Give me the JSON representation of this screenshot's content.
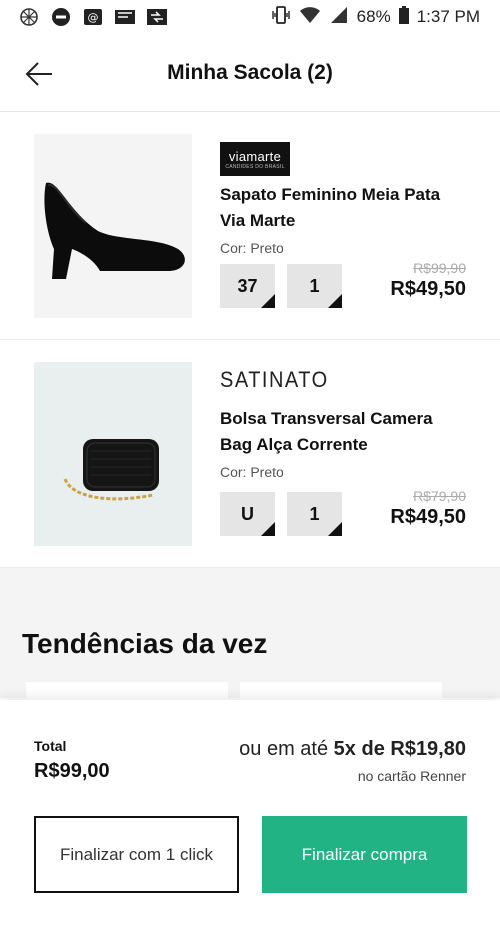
{
  "status_bar": {
    "battery": "68%",
    "time": "1:37 PM",
    "left_icons": [
      "settings-icon",
      "block-icon",
      "email-icon",
      "chat-icon",
      "transfer-icon"
    ]
  },
  "header": {
    "title": "Minha Sacola (2)"
  },
  "items": [
    {
      "brand_logo_main": "viamarte",
      "brand_logo_sub": "CANDIDES DO BRASIL",
      "name": "Sapato Feminino Meia Pata Via Marte",
      "color": "Cor: Preto",
      "size": "37",
      "quantity": "1",
      "old_price": "R$99,90",
      "price": "R$49,50"
    },
    {
      "brand": "SATINATO",
      "name": "Bolsa Transversal Camera Bag Alça Corrente",
      "color": "Cor: Preto",
      "size": "U",
      "quantity": "1",
      "old_price": "R$79,90",
      "price": "R$49,50"
    }
  ],
  "trends": {
    "title": "Tendências da vez"
  },
  "summary": {
    "total_label": "Total",
    "total_value": "R$99,00",
    "install_prefix": "ou em até ",
    "install_value": "5x de R$19,80",
    "install_note": "no cartão Renner"
  },
  "buttons": {
    "one_click": "Finalizar com 1 click",
    "checkout": "Finalizar compra"
  },
  "colors": {
    "accent": "#21b383",
    "text": "#111111"
  }
}
